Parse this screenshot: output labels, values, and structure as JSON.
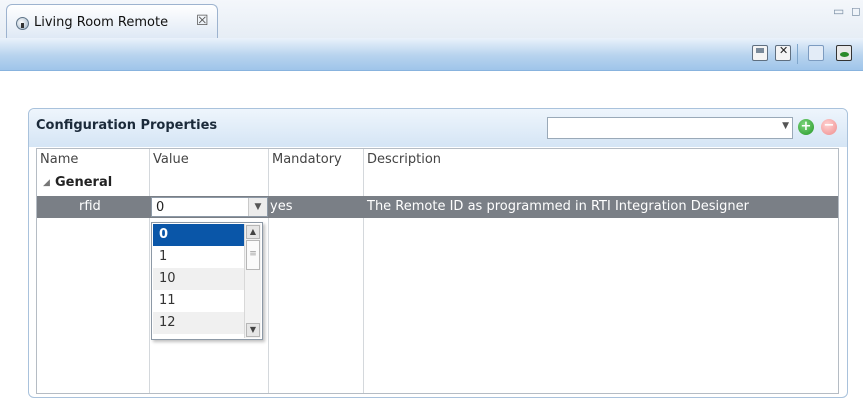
{
  "editor_tab": {
    "title": "Living Room Remote",
    "close_glyph": "☒",
    "icon": "remote-icon"
  },
  "window_controls": {
    "minimize_glyph": "▭",
    "maximize_glyph": "◻"
  },
  "toolbar": {
    "icons": [
      "save-icon",
      "save-as-icon",
      "filter-icon",
      "show-hidden-icon"
    ]
  },
  "section": {
    "title": "Configuration Properties",
    "filter_combo_value": "",
    "add_glyph": "+",
    "remove_glyph": "−"
  },
  "table": {
    "columns": [
      "Name",
      "Value",
      "Mandatory",
      "Description"
    ],
    "group": {
      "label": "General",
      "expanded_glyph": "◢"
    },
    "rows": [
      {
        "name": "rfid",
        "value": "0",
        "mandatory": "yes",
        "description": "The Remote ID as programmed in RTI Integration Designer"
      }
    ]
  },
  "value_dropdown": {
    "selected": "0",
    "visible_options": [
      "0",
      "1",
      "10",
      "11",
      "12"
    ]
  },
  "colors": {
    "accent": "#9fc5ea",
    "selected_row": "#7a7f86",
    "selected_option": "#0a56a8",
    "add": "#249624",
    "remove": "#ee8c8c"
  }
}
